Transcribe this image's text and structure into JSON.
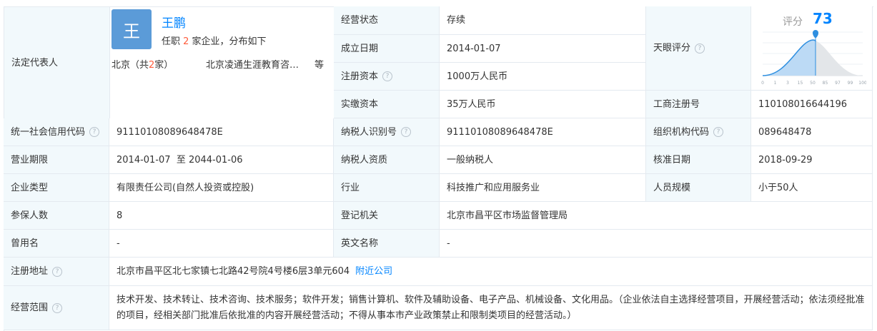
{
  "legal_rep": {
    "label": "法定代表人",
    "avatar_char": "王",
    "name": "王鹏",
    "desc_prefix": "任职 ",
    "desc_count": "2",
    "desc_suffix": " 家企业，分布如下",
    "city_prefix": "北京（共",
    "city_count": "2",
    "city_suffix": "家）",
    "company": "北京凌通生涯教育咨…",
    "more": "等"
  },
  "status": {
    "label": "经营状态",
    "value": "存续"
  },
  "founded": {
    "label": "成立日期",
    "value": "2014-01-07"
  },
  "reg_capital": {
    "label": "注册资本",
    "value": "1000万人民币"
  },
  "paid_capital": {
    "label": "实缴资本",
    "value": "35万人民币"
  },
  "tianyan": {
    "label": "天眼评分",
    "score_label": "评分",
    "score": "73",
    "score_value": 73,
    "axis": [
      "0",
      "1",
      "3",
      "15",
      "50",
      "85",
      "97",
      "99",
      "100"
    ]
  },
  "biz_reg_no": {
    "label": "工商注册号",
    "value": "110108016644196"
  },
  "credit_code": {
    "label": "统一社会信用代码",
    "value": "91110108089648478E"
  },
  "taxpayer_id": {
    "label": "纳税人识别号",
    "value": "91110108089648478E"
  },
  "org_code": {
    "label": "组织机构代码",
    "value": "089648478"
  },
  "biz_term": {
    "label": "营业期限",
    "value": "2014-01-07  至 2044-01-06"
  },
  "taxpayer_qual": {
    "label": "纳税人资质",
    "value": "一般纳税人"
  },
  "approve_date": {
    "label": "核准日期",
    "value": "2018-09-29"
  },
  "ent_type": {
    "label": "企业类型",
    "value": "有限责任公司(自然人投资或控股)"
  },
  "industry": {
    "label": "行业",
    "value": "科技推广和应用服务业"
  },
  "staff_size": {
    "label": "人员规模",
    "value": "小于50人"
  },
  "insured": {
    "label": "参保人数",
    "value": "8"
  },
  "reg_authority": {
    "label": "登记机关",
    "value": "北京市昌平区市场监督管理局"
  },
  "former_name": {
    "label": "曾用名",
    "value": "-"
  },
  "english_name": {
    "label": "英文名称",
    "value": "-"
  },
  "reg_address": {
    "label": "注册地址",
    "value": "北京市昌平区北七家镇七北路42号院4号楼6层3单元604",
    "link": "附近公司"
  },
  "biz_scope": {
    "label": "经营范围",
    "value": "技术开发、技术转让、技术咨询、技术服务；软件开发；销售计算机、软件及辅助设备、电子产品、机械设备、文化用品。（企业依法自主选择经营项目，开展经营活动；依法须经批准的项目，经相关部门批准后依批准的内容开展经营活动；不得从事本市产业政策禁止和限制类项目的经营活动。）"
  },
  "help_glyph": "?",
  "colors": {
    "label_bg": "#f2f9fc",
    "border": "#e4eaf0",
    "link": "#0084ff",
    "highlight": "#ff5b3b",
    "gauge": "#2e8fe0"
  }
}
